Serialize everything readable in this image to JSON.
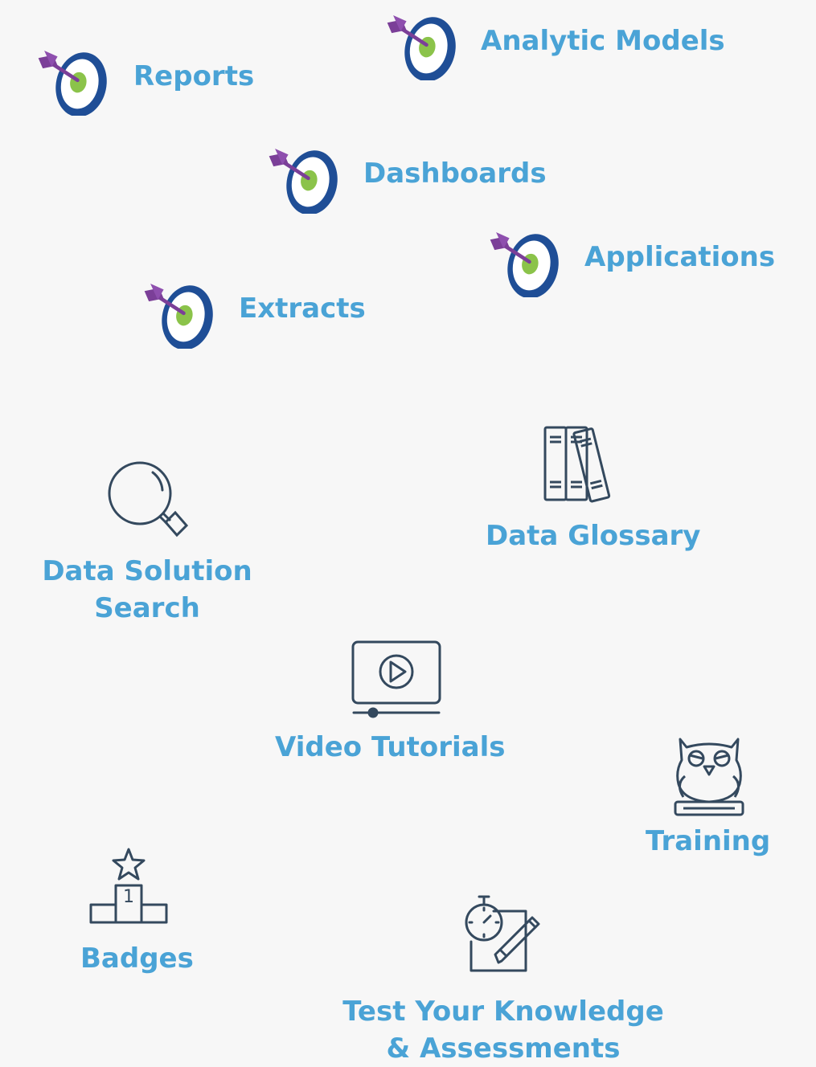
{
  "colors": {
    "background": "#f7f7f7",
    "label": "#4aa3d6",
    "icon_stroke": "#34495e",
    "target_ring": "#1f4e96",
    "target_center": "#8bc34a",
    "dart": "#7b3f98"
  },
  "targets": [
    {
      "label": "Reports",
      "icon": "target-dart-icon"
    },
    {
      "label": "Analytic Models",
      "icon": "target-dart-icon"
    },
    {
      "label": "Dashboards",
      "icon": "target-dart-icon"
    },
    {
      "label": "Applications",
      "icon": "target-dart-icon"
    },
    {
      "label": "Extracts",
      "icon": "target-dart-icon"
    }
  ],
  "tools": {
    "search": {
      "label_line1": "Data Solution",
      "label_line2": "Search",
      "icon": "magnifier-icon"
    },
    "glossary": {
      "label": "Data Glossary",
      "icon": "books-icon"
    },
    "video": {
      "label": "Video Tutorials",
      "icon": "video-play-icon"
    },
    "training": {
      "label": "Training",
      "icon": "owl-icon"
    },
    "badges": {
      "label": "Badges",
      "icon": "podium-star-icon",
      "podium_number": "1"
    },
    "test": {
      "label_line1": "Test Your Knowledge",
      "label_line2": "& Assessments",
      "icon": "stopwatch-notepad-icon"
    }
  }
}
